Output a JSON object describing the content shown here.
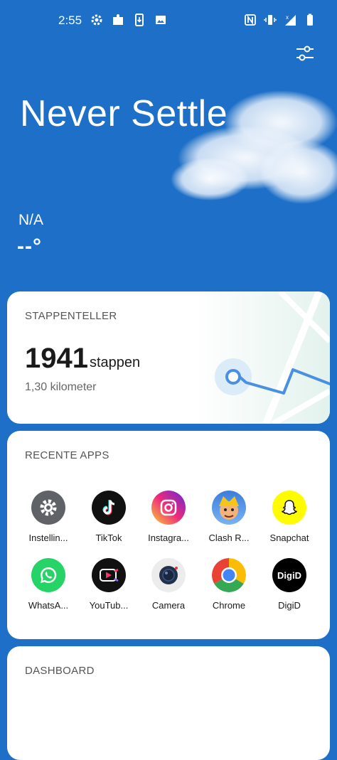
{
  "status_bar": {
    "time": "2:55",
    "icons_left": [
      "gear-icon",
      "puzzle-icon",
      "download-icon",
      "image-icon"
    ],
    "icons_right": [
      "nfc-icon",
      "vibrate-icon",
      "signal-icon",
      "battery-icon"
    ]
  },
  "hero": {
    "title": "Never Settle",
    "weather_location": "N/A",
    "weather_temperature": "--°"
  },
  "steps": {
    "title": "STAPPENTELLER",
    "count": "1941",
    "unit": "stappen",
    "distance": "1,30 kilometer"
  },
  "recent_apps": {
    "title": "RECENTE APPS",
    "apps": [
      {
        "label": "Instellin...",
        "icon": "settings-gear-icon",
        "color": "#5f6368"
      },
      {
        "label": "TikTok",
        "icon": "tiktok-icon",
        "color": "#111111"
      },
      {
        "label": "Instagra...",
        "icon": "instagram-icon",
        "color": "#d6249f"
      },
      {
        "label": "Clash R...",
        "icon": "clash-royale-icon",
        "color": "#3b7ddd"
      },
      {
        "label": "Snapchat",
        "icon": "snapchat-ghost-icon",
        "color": "#fffc00"
      },
      {
        "label": "WhatsA...",
        "icon": "whatsapp-icon",
        "color": "#25d366"
      },
      {
        "label": "YouTub...",
        "icon": "youtube-create-icon",
        "color": "#111111"
      },
      {
        "label": "Camera",
        "icon": "camera-icon",
        "color": "#eeeeee"
      },
      {
        "label": "Chrome",
        "icon": "chrome-icon",
        "color": "#4285f4"
      },
      {
        "label": "DigiD",
        "icon": "digid-icon",
        "color": "#000000"
      }
    ],
    "digid_icon_text": "DigiD"
  },
  "dashboard": {
    "title": "DASHBOARD"
  }
}
